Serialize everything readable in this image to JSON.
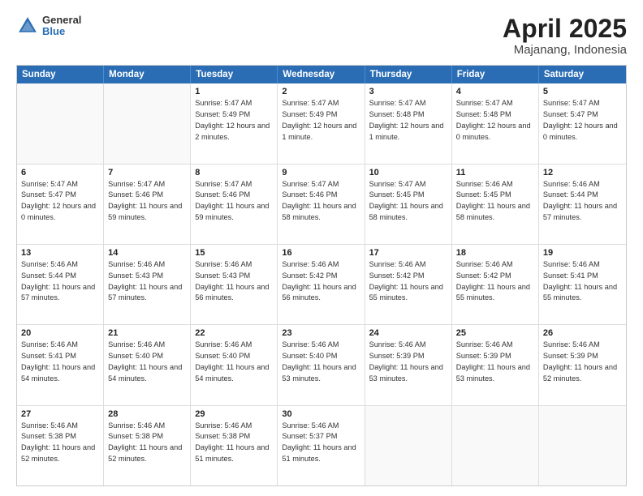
{
  "logo": {
    "general": "General",
    "blue": "Blue"
  },
  "title": "April 2025",
  "subtitle": "Majanang, Indonesia",
  "header_days": [
    "Sunday",
    "Monday",
    "Tuesday",
    "Wednesday",
    "Thursday",
    "Friday",
    "Saturday"
  ],
  "rows": [
    [
      {
        "day": "",
        "sunrise": "",
        "sunset": "",
        "daylight": ""
      },
      {
        "day": "",
        "sunrise": "",
        "sunset": "",
        "daylight": ""
      },
      {
        "day": "1",
        "sunrise": "Sunrise: 5:47 AM",
        "sunset": "Sunset: 5:49 PM",
        "daylight": "Daylight: 12 hours and 2 minutes."
      },
      {
        "day": "2",
        "sunrise": "Sunrise: 5:47 AM",
        "sunset": "Sunset: 5:49 PM",
        "daylight": "Daylight: 12 hours and 1 minute."
      },
      {
        "day": "3",
        "sunrise": "Sunrise: 5:47 AM",
        "sunset": "Sunset: 5:48 PM",
        "daylight": "Daylight: 12 hours and 1 minute."
      },
      {
        "day": "4",
        "sunrise": "Sunrise: 5:47 AM",
        "sunset": "Sunset: 5:48 PM",
        "daylight": "Daylight: 12 hours and 0 minutes."
      },
      {
        "day": "5",
        "sunrise": "Sunrise: 5:47 AM",
        "sunset": "Sunset: 5:47 PM",
        "daylight": "Daylight: 12 hours and 0 minutes."
      }
    ],
    [
      {
        "day": "6",
        "sunrise": "Sunrise: 5:47 AM",
        "sunset": "Sunset: 5:47 PM",
        "daylight": "Daylight: 12 hours and 0 minutes."
      },
      {
        "day": "7",
        "sunrise": "Sunrise: 5:47 AM",
        "sunset": "Sunset: 5:46 PM",
        "daylight": "Daylight: 11 hours and 59 minutes."
      },
      {
        "day": "8",
        "sunrise": "Sunrise: 5:47 AM",
        "sunset": "Sunset: 5:46 PM",
        "daylight": "Daylight: 11 hours and 59 minutes."
      },
      {
        "day": "9",
        "sunrise": "Sunrise: 5:47 AM",
        "sunset": "Sunset: 5:46 PM",
        "daylight": "Daylight: 11 hours and 58 minutes."
      },
      {
        "day": "10",
        "sunrise": "Sunrise: 5:47 AM",
        "sunset": "Sunset: 5:45 PM",
        "daylight": "Daylight: 11 hours and 58 minutes."
      },
      {
        "day": "11",
        "sunrise": "Sunrise: 5:46 AM",
        "sunset": "Sunset: 5:45 PM",
        "daylight": "Daylight: 11 hours and 58 minutes."
      },
      {
        "day": "12",
        "sunrise": "Sunrise: 5:46 AM",
        "sunset": "Sunset: 5:44 PM",
        "daylight": "Daylight: 11 hours and 57 minutes."
      }
    ],
    [
      {
        "day": "13",
        "sunrise": "Sunrise: 5:46 AM",
        "sunset": "Sunset: 5:44 PM",
        "daylight": "Daylight: 11 hours and 57 minutes."
      },
      {
        "day": "14",
        "sunrise": "Sunrise: 5:46 AM",
        "sunset": "Sunset: 5:43 PM",
        "daylight": "Daylight: 11 hours and 57 minutes."
      },
      {
        "day": "15",
        "sunrise": "Sunrise: 5:46 AM",
        "sunset": "Sunset: 5:43 PM",
        "daylight": "Daylight: 11 hours and 56 minutes."
      },
      {
        "day": "16",
        "sunrise": "Sunrise: 5:46 AM",
        "sunset": "Sunset: 5:42 PM",
        "daylight": "Daylight: 11 hours and 56 minutes."
      },
      {
        "day": "17",
        "sunrise": "Sunrise: 5:46 AM",
        "sunset": "Sunset: 5:42 PM",
        "daylight": "Daylight: 11 hours and 55 minutes."
      },
      {
        "day": "18",
        "sunrise": "Sunrise: 5:46 AM",
        "sunset": "Sunset: 5:42 PM",
        "daylight": "Daylight: 11 hours and 55 minutes."
      },
      {
        "day": "19",
        "sunrise": "Sunrise: 5:46 AM",
        "sunset": "Sunset: 5:41 PM",
        "daylight": "Daylight: 11 hours and 55 minutes."
      }
    ],
    [
      {
        "day": "20",
        "sunrise": "Sunrise: 5:46 AM",
        "sunset": "Sunset: 5:41 PM",
        "daylight": "Daylight: 11 hours and 54 minutes."
      },
      {
        "day": "21",
        "sunrise": "Sunrise: 5:46 AM",
        "sunset": "Sunset: 5:40 PM",
        "daylight": "Daylight: 11 hours and 54 minutes."
      },
      {
        "day": "22",
        "sunrise": "Sunrise: 5:46 AM",
        "sunset": "Sunset: 5:40 PM",
        "daylight": "Daylight: 11 hours and 54 minutes."
      },
      {
        "day": "23",
        "sunrise": "Sunrise: 5:46 AM",
        "sunset": "Sunset: 5:40 PM",
        "daylight": "Daylight: 11 hours and 53 minutes."
      },
      {
        "day": "24",
        "sunrise": "Sunrise: 5:46 AM",
        "sunset": "Sunset: 5:39 PM",
        "daylight": "Daylight: 11 hours and 53 minutes."
      },
      {
        "day": "25",
        "sunrise": "Sunrise: 5:46 AM",
        "sunset": "Sunset: 5:39 PM",
        "daylight": "Daylight: 11 hours and 53 minutes."
      },
      {
        "day": "26",
        "sunrise": "Sunrise: 5:46 AM",
        "sunset": "Sunset: 5:39 PM",
        "daylight": "Daylight: 11 hours and 52 minutes."
      }
    ],
    [
      {
        "day": "27",
        "sunrise": "Sunrise: 5:46 AM",
        "sunset": "Sunset: 5:38 PM",
        "daylight": "Daylight: 11 hours and 52 minutes."
      },
      {
        "day": "28",
        "sunrise": "Sunrise: 5:46 AM",
        "sunset": "Sunset: 5:38 PM",
        "daylight": "Daylight: 11 hours and 52 minutes."
      },
      {
        "day": "29",
        "sunrise": "Sunrise: 5:46 AM",
        "sunset": "Sunset: 5:38 PM",
        "daylight": "Daylight: 11 hours and 51 minutes."
      },
      {
        "day": "30",
        "sunrise": "Sunrise: 5:46 AM",
        "sunset": "Sunset: 5:37 PM",
        "daylight": "Daylight: 11 hours and 51 minutes."
      },
      {
        "day": "",
        "sunrise": "",
        "sunset": "",
        "daylight": ""
      },
      {
        "day": "",
        "sunrise": "",
        "sunset": "",
        "daylight": ""
      },
      {
        "day": "",
        "sunrise": "",
        "sunset": "",
        "daylight": ""
      }
    ]
  ]
}
